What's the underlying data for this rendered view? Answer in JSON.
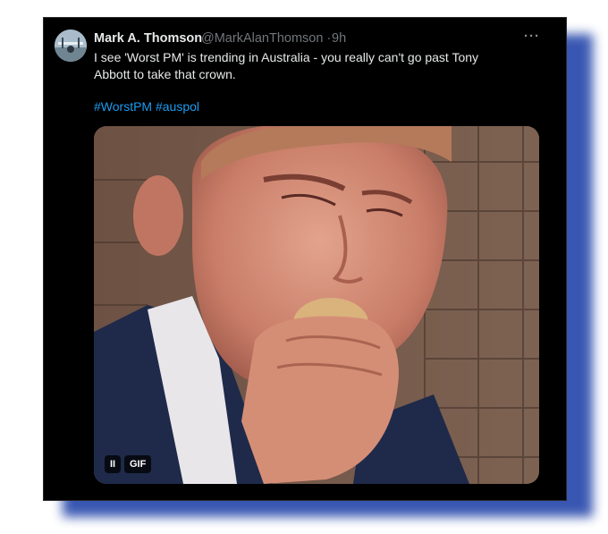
{
  "tweet": {
    "author_name": "Mark A. Thomson",
    "handle": "@MarkAlanThomson",
    "separator": "·",
    "time": "9h",
    "more_icon": "more-horizontal-icon",
    "text": "I see 'Worst PM' is trending in Australia - you really can't go past Tony Abbott to take that crown.",
    "hashtags": [
      "#WorstPM",
      "#auspol"
    ]
  },
  "media": {
    "type": "gif",
    "pause_label": "II",
    "badge_label": "GIF"
  },
  "colors": {
    "background": "#000000",
    "text": "#e7e9ea",
    "muted": "#71767b",
    "link": "#1d9bf0",
    "frame_shadow": "#2f4fae"
  }
}
